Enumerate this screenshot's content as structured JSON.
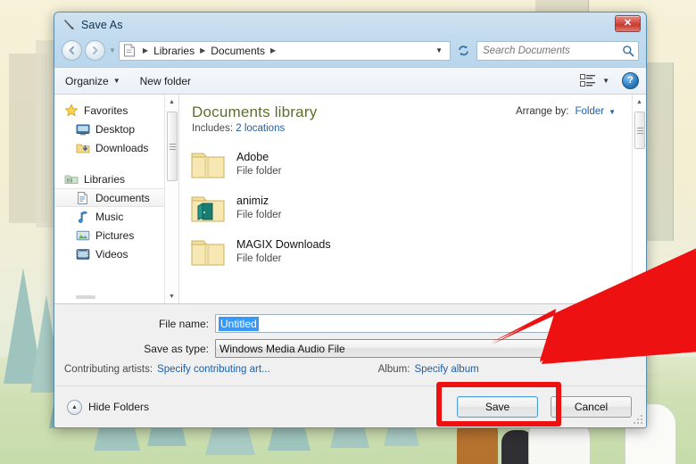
{
  "window": {
    "title": "Save As",
    "title_icon": "pen-tool-icon",
    "close_label": "✕"
  },
  "addressbar": {
    "back_label": "◀",
    "forward_label": "▶",
    "history_caret": "▼",
    "path_icon": "document-icon",
    "crumbs": [
      "Libraries",
      "Documents"
    ],
    "separator": "▶",
    "dropdown_caret": "▼",
    "refresh_label": "↻"
  },
  "search": {
    "placeholder": "Search Documents",
    "value": "",
    "icon": "search-icon"
  },
  "toolbar": {
    "organize_label": "Organize",
    "organize_caret": "▼",
    "new_folder_label": "New folder",
    "view_icon": "list-view-icon",
    "view_caret": "▼",
    "help_label": "?"
  },
  "navpane": {
    "groups": [
      {
        "header": {
          "label": "Favorites",
          "icon": "star-icon"
        },
        "items": [
          {
            "label": "Desktop",
            "icon": "desktop-icon"
          },
          {
            "label": "Downloads",
            "icon": "downloads-folder-icon"
          }
        ]
      },
      {
        "header": {
          "label": "Libraries",
          "icon": "libraries-icon"
        },
        "items": [
          {
            "label": "Documents",
            "icon": "documents-library-icon",
            "selected": true
          },
          {
            "label": "Music",
            "icon": "music-note-icon",
            "selected": false
          },
          {
            "label": "Pictures",
            "icon": "pictures-icon",
            "selected": false
          },
          {
            "label": "Videos",
            "icon": "videos-icon",
            "selected": false
          }
        ]
      }
    ],
    "scroll_up": "▲",
    "scroll_down": "▼"
  },
  "library": {
    "title": "Documents library",
    "includes_label": "Includes:",
    "locations_link": "2 locations",
    "arrange_label": "Arrange by:",
    "arrange_value": "Folder",
    "arrange_caret": "▼"
  },
  "files": {
    "scroll_up": "▲",
    "rows": [
      {
        "name": "Adobe",
        "type": "File folder",
        "icon": "folder-icon"
      },
      {
        "name": "animiz",
        "type": "File folder",
        "icon": "folder-open-teal-icon"
      },
      {
        "name": "MAGIX Downloads",
        "type": "File folder",
        "icon": "folder-icon"
      }
    ]
  },
  "form": {
    "filename_label": "File name:",
    "filename_value": "Untitled",
    "savetype_label": "Save as type:",
    "savetype_value": "Windows Media Audio File",
    "savetype_caret": "▼",
    "contributing_label": "Contributing artists:",
    "contributing_link": "Specify contributing art...",
    "album_label": "Album:",
    "album_link": "Specify album"
  },
  "footer": {
    "hide_folders_label": "Hide Folders",
    "hide_folders_icon": "chevron-up-circle-icon",
    "save_label": "Save",
    "cancel_label": "Cancel"
  },
  "annotations": {
    "highlight_color": "#ee1111",
    "arrow_color": "#ee1111",
    "arrow_name": "red-pointer-arrow",
    "highlight_target": "save-button"
  }
}
